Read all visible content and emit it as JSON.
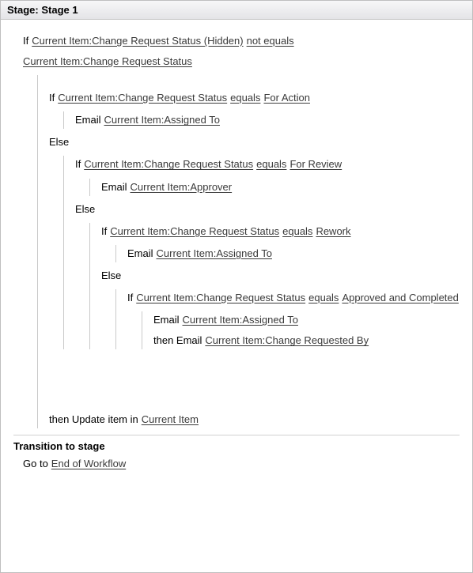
{
  "header": {
    "title": "Stage: Stage 1"
  },
  "kw": {
    "if": "If",
    "else": "Else",
    "email": "Email",
    "then_email": "then Email",
    "then_update": "then Update item in",
    "goto": "Go to"
  },
  "cond1": {
    "left": "Current Item:Change Request Status (Hidden)",
    "op": "not equals",
    "right": "Current Item:Change Request Status"
  },
  "cond2": {
    "left": "Current Item:Change Request Status",
    "op": "equals",
    "right": "For Action"
  },
  "cond3": {
    "left": "Current Item:Change Request Status",
    "op": "equals",
    "right": "For Review"
  },
  "cond4": {
    "left": "Current Item:Change Request Status",
    "op": "equals",
    "right": "Rework"
  },
  "cond5": {
    "left": "Current Item:Change Request Status",
    "op": "equals",
    "right": "Approved and Completed"
  },
  "email": {
    "assignedTo": "Current Item:Assigned To",
    "approver": "Current Item:Approver",
    "requestedBy": "Current Item:Change Requested By"
  },
  "update": {
    "target": "Current Item"
  },
  "transition": {
    "title": "Transition to stage",
    "target": "End of Workflow"
  }
}
